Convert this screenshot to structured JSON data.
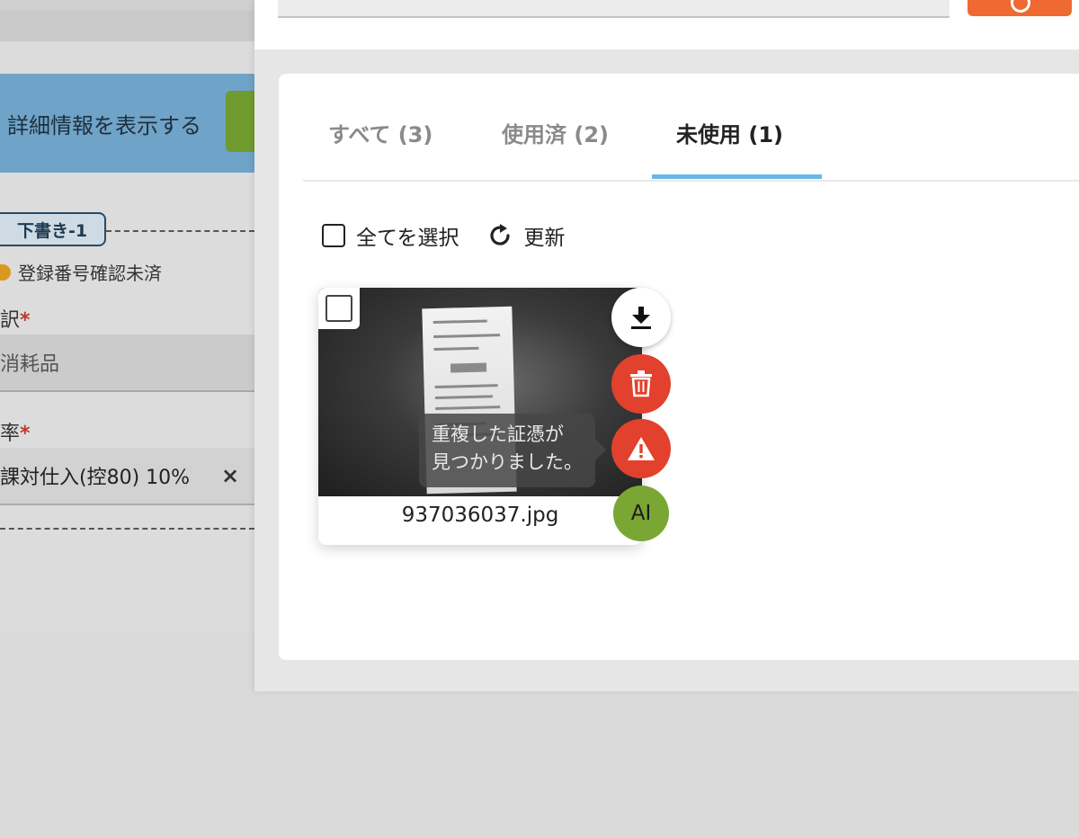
{
  "background_form": {
    "detail_button_label": "詳細情報を表示する",
    "draft_badge": "下書き-1",
    "registration_status": "登録番号確認未済",
    "account_label": "訳",
    "account_value": "消耗品",
    "tax_label": "率",
    "tax_value": "課対仕入(控80) 10%",
    "required_mark": "*",
    "clear_icon": "×"
  },
  "tabs": [
    {
      "label": "すべて (3)",
      "active": false
    },
    {
      "label": "使用済 (2)",
      "active": false
    },
    {
      "label": "未使用 (1)",
      "active": true
    }
  ],
  "toolbar": {
    "select_all_label": "全てを選択",
    "refresh_label": "更新"
  },
  "files": [
    {
      "filename": "937036037.jpg",
      "warning_tooltip_line1": "重複した証憑が",
      "warning_tooltip_line2": "見つかりました。",
      "ai_label": "AI",
      "actions": [
        "download-icon",
        "trash-icon",
        "warning-icon",
        "ai-badge"
      ]
    }
  ],
  "colors": {
    "active_tab_underline": "#6cb6e6",
    "delete_red": "#e2412d",
    "ai_green": "#7aa733",
    "accent_orange": "#ee6a32",
    "detail_blue": "#6fa3c7"
  }
}
